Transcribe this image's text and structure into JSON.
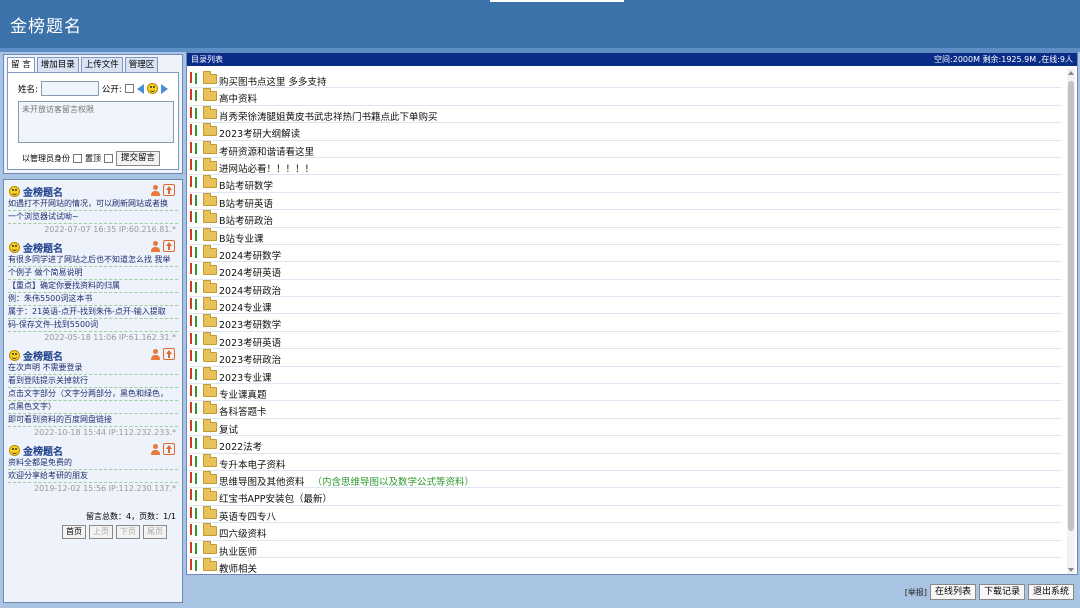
{
  "app": {
    "title": "金榜题名"
  },
  "tabs": [
    "留 言",
    "增加目录",
    "上传文件",
    "管理区"
  ],
  "form": {
    "name_label": "姓名:",
    "public_label": "公开:",
    "message_placeholder": "未开放访客留言权限",
    "admin_label": "以管理员身份",
    "pin_label": "置顶",
    "submit_label": "提交留言"
  },
  "messages": [
    {
      "name": "金榜题名",
      "lines": [
        "如遇打不开网站的情况，可以刷新网站或者换",
        "一个浏览器试试呦~"
      ],
      "meta": "2022-07-07 16:35 IP:60.216.81.*"
    },
    {
      "name": "金榜题名",
      "lines": [
        "有很多同学进了网站之后也不知道怎么找 我举",
        "个例子 做个简易说明",
        "【重点】确定你要找资料的归属",
        "例：朱伟5500词这本书",
        "属于：21英语-点开-找到朱伟-点开-输入提取",
        "码-保存文件-找到5500词"
      ],
      "meta": "2022-05-18 11:06 IP:61.162.31.*"
    },
    {
      "name": "金榜题名",
      "lines": [
        "在次声明 不需要登录",
        "看到登陆提示关掉就行",
        "点击文字部分（文字分两部分，黑色和绿色，",
        "点黑色文字）",
        "即可看到资料的百度网盘链接"
      ],
      "meta": "2022-10-18 15:44 IP:112.232.233.*"
    },
    {
      "name": "金榜题名",
      "lines": [
        "资料全都是免费的",
        "欢迎分享给考研的朋友"
      ],
      "meta": "2019-12-02 15:56 IP:112.230.137.*"
    }
  ],
  "pager": {
    "summary": "留言总数：4，页数：1/1",
    "first": "首页",
    "prev": "上页",
    "next": "下页",
    "last": "尾页"
  },
  "directory": {
    "header_left": "目录列表",
    "header_right": "空间:2000M 剩余:1925.9M ,在线:9人",
    "items": [
      {
        "name": "购买图书点这里 多多支持",
        "note": ""
      },
      {
        "name": "高中资料",
        "note": ""
      },
      {
        "name": "肖秀荣徐涛腿姐黄皮书武忠祥热门书籍点此下单购买",
        "note": ""
      },
      {
        "name": "2023考研大纲解读",
        "note": ""
      },
      {
        "name": "考研资源和谐请看这里",
        "note": ""
      },
      {
        "name": "进网站必看！！！！！",
        "note": ""
      },
      {
        "name": "B站考研数学",
        "note": ""
      },
      {
        "name": "B站考研英语",
        "note": ""
      },
      {
        "name": "B站考研政治",
        "note": ""
      },
      {
        "name": "B站专业课",
        "note": ""
      },
      {
        "name": "2024考研数学",
        "note": ""
      },
      {
        "name": "2024考研英语",
        "note": ""
      },
      {
        "name": "2024考研政治",
        "note": ""
      },
      {
        "name": "2024专业课",
        "note": ""
      },
      {
        "name": "2023考研数学",
        "note": ""
      },
      {
        "name": "2023考研英语",
        "note": ""
      },
      {
        "name": "2023考研政治",
        "note": ""
      },
      {
        "name": "2023专业课",
        "note": ""
      },
      {
        "name": "专业课真题",
        "note": ""
      },
      {
        "name": "各科答题卡",
        "note": ""
      },
      {
        "name": "复试",
        "note": ""
      },
      {
        "name": "2022法考",
        "note": ""
      },
      {
        "name": "专升本电子资料",
        "note": ""
      },
      {
        "name": "思维导图及其他资料",
        "note": "（内含思维导图以及数学公式等资料）"
      },
      {
        "name": "红宝书APP安装包（最新）",
        "note": ""
      },
      {
        "name": "英语专四专八",
        "note": ""
      },
      {
        "name": "四六级资料",
        "note": ""
      },
      {
        "name": "执业医师",
        "note": ""
      },
      {
        "name": "教师相关",
        "note": ""
      }
    ]
  },
  "bottom": {
    "report": "[举报]",
    "online_list": "在线列表",
    "download_log": "下载记录",
    "exit": "退出系统"
  }
}
